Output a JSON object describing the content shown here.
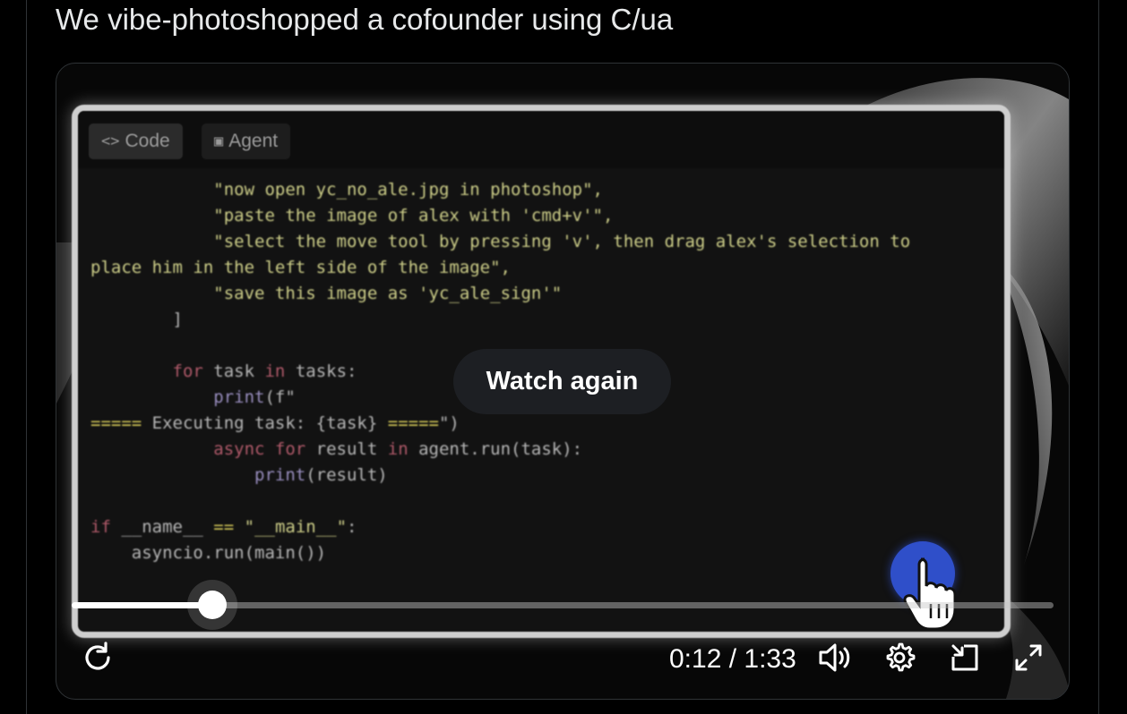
{
  "tweet": {
    "text": "We vibe-photoshopped a cofounder using C/ua"
  },
  "video": {
    "tabs": [
      {
        "glyph": "<>",
        "label": "Code"
      },
      {
        "glyph": "▣",
        "label": "Agent"
      }
    ],
    "code_lines": [
      [
        {
          "t": "            "
        },
        {
          "t": "\"now open yc_no_ale.jpg in photoshop\",",
          "c": "s"
        }
      ],
      [
        {
          "t": "            "
        },
        {
          "t": "\"paste the image of alex with 'cmd+v'\",",
          "c": "s"
        }
      ],
      [
        {
          "t": "            "
        },
        {
          "t": "\"select the move tool by pressing 'v', then drag alex's selection to",
          "c": "s"
        }
      ],
      [
        {
          "t": "place him in the left side of the image\",",
          "c": "s"
        }
      ],
      [
        {
          "t": "            "
        },
        {
          "t": "\"save this image as 'yc_ale_sign'\"",
          "c": "s"
        }
      ],
      [
        {
          "t": "        ]"
        }
      ],
      [
        {
          "t": ""
        }
      ],
      [
        {
          "t": "        "
        },
        {
          "t": "for",
          "c": "k"
        },
        {
          "t": " task "
        },
        {
          "t": "in",
          "c": "k"
        },
        {
          "t": " tasks:"
        }
      ],
      [
        {
          "t": "            "
        },
        {
          "t": "print",
          "c": "f"
        },
        {
          "t": "(f\""
        }
      ],
      [
        {
          "t": "=====",
          "c": "y"
        },
        {
          "t": " Executing task: {task} "
        },
        {
          "t": "=====",
          "c": "y"
        },
        {
          "t": "\")"
        }
      ],
      [
        {
          "t": "            "
        },
        {
          "t": "async for",
          "c": "k"
        },
        {
          "t": " result "
        },
        {
          "t": "in",
          "c": "k"
        },
        {
          "t": " agent.run(task):"
        }
      ],
      [
        {
          "t": "                "
        },
        {
          "t": "print",
          "c": "f"
        },
        {
          "t": "(result)"
        }
      ],
      [
        {
          "t": ""
        }
      ],
      [
        {
          "t": "if",
          "c": "k"
        },
        {
          "t": " __name__ "
        },
        {
          "t": "==",
          "c": "y"
        },
        {
          "t": " "
        },
        {
          "t": "\"__main__\"",
          "c": "s"
        },
        {
          "t": ":"
        }
      ],
      [
        {
          "t": "    asyncio.run(main())"
        }
      ]
    ],
    "overlay_label": "Watch again",
    "progress": {
      "fraction": 0.143
    },
    "time": {
      "current": "0:12",
      "separator": " / ",
      "total": "1:33",
      "display": "0:12 / 1:33"
    },
    "controls": {
      "replay_icon": "replay-icon",
      "volume_icon": "volume-icon",
      "settings_icon": "gear-icon",
      "dock_icon": "dock-icon",
      "fullscreen_icon": "fullscreen-icon"
    }
  },
  "colors": {
    "background": "#000000",
    "text": "#e7e9ea",
    "border": "#2f3336",
    "cursor_blue": "#2f4fc9"
  }
}
